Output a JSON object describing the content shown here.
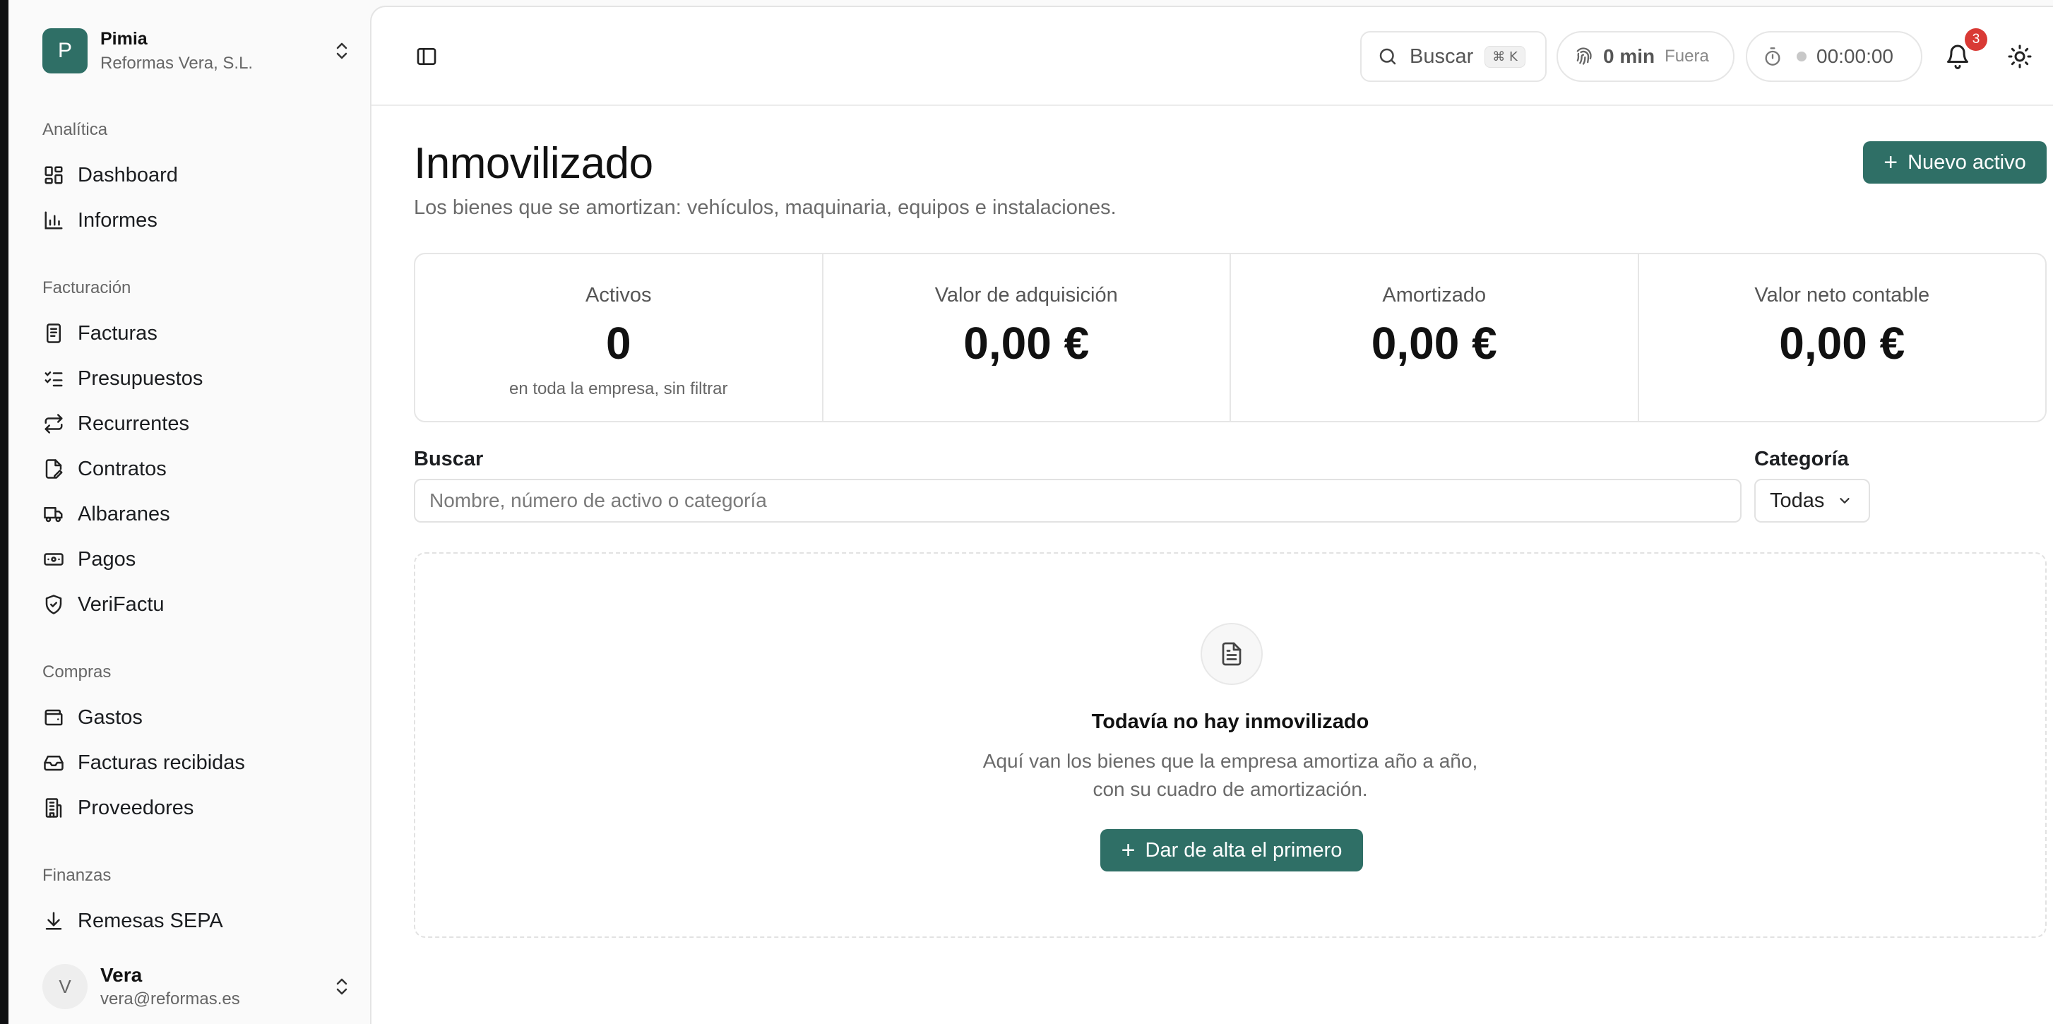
{
  "workspace": {
    "initial": "P",
    "name": "Pimia",
    "company": "Reformas Vera, S.L."
  },
  "sidebar": {
    "sections": [
      {
        "label": "Analítica",
        "items": [
          {
            "label": "Dashboard",
            "icon": "dashboard-icon"
          },
          {
            "label": "Informes",
            "icon": "bar-chart-icon"
          }
        ]
      },
      {
        "label": "Facturación",
        "items": [
          {
            "label": "Facturas",
            "icon": "invoice-icon"
          },
          {
            "label": "Presupuestos",
            "icon": "checklist-icon"
          },
          {
            "label": "Recurrentes",
            "icon": "repeat-icon"
          },
          {
            "label": "Contratos",
            "icon": "file-pen-icon"
          },
          {
            "label": "Albaranes",
            "icon": "truck-icon"
          },
          {
            "label": "Pagos",
            "icon": "banknote-icon"
          },
          {
            "label": "VeriFactu",
            "icon": "shield-check-icon"
          }
        ]
      },
      {
        "label": "Compras",
        "items": [
          {
            "label": "Gastos",
            "icon": "wallet-icon"
          },
          {
            "label": "Facturas recibidas",
            "icon": "inbox-icon"
          },
          {
            "label": "Proveedores",
            "icon": "building-icon"
          }
        ]
      },
      {
        "label": "Finanzas",
        "items": [
          {
            "label": "Remesas SEPA",
            "icon": "download-icon"
          }
        ]
      }
    ]
  },
  "user": {
    "initial": "V",
    "name": "Vera",
    "email": "vera@reformas.es"
  },
  "topbar": {
    "search_label": "Buscar",
    "search_shortcut": "⌘ K",
    "time_value": "0 min",
    "time_status": "Fuera",
    "timer": "00:00:00",
    "notifications_count": "3"
  },
  "page": {
    "title": "Inmovilizado",
    "subtitle": "Los bienes que se amortizan: vehículos, maquinaria, equipos e instalaciones.",
    "new_button": "Nuevo activo"
  },
  "stats": [
    {
      "label": "Activos",
      "value": "0",
      "note": "en toda la empresa, sin filtrar"
    },
    {
      "label": "Valor de adquisición",
      "value": "0,00 €",
      "note": ""
    },
    {
      "label": "Amortizado",
      "value": "0,00 €",
      "note": ""
    },
    {
      "label": "Valor neto contable",
      "value": "0,00 €",
      "note": ""
    }
  ],
  "filters": {
    "search_label": "Buscar",
    "search_placeholder": "Nombre, número de activo o categoría",
    "category_label": "Categoría",
    "category_value": "Todas"
  },
  "empty": {
    "title": "Todavía no hay inmovilizado",
    "desc_line1": "Aquí van los bienes que la empresa amortiza año a año,",
    "desc_line2": "con su cuadro de amortización.",
    "button": "Dar de alta el primero"
  },
  "colors": {
    "accent": "#2f6f66",
    "badge": "#d93a35"
  }
}
